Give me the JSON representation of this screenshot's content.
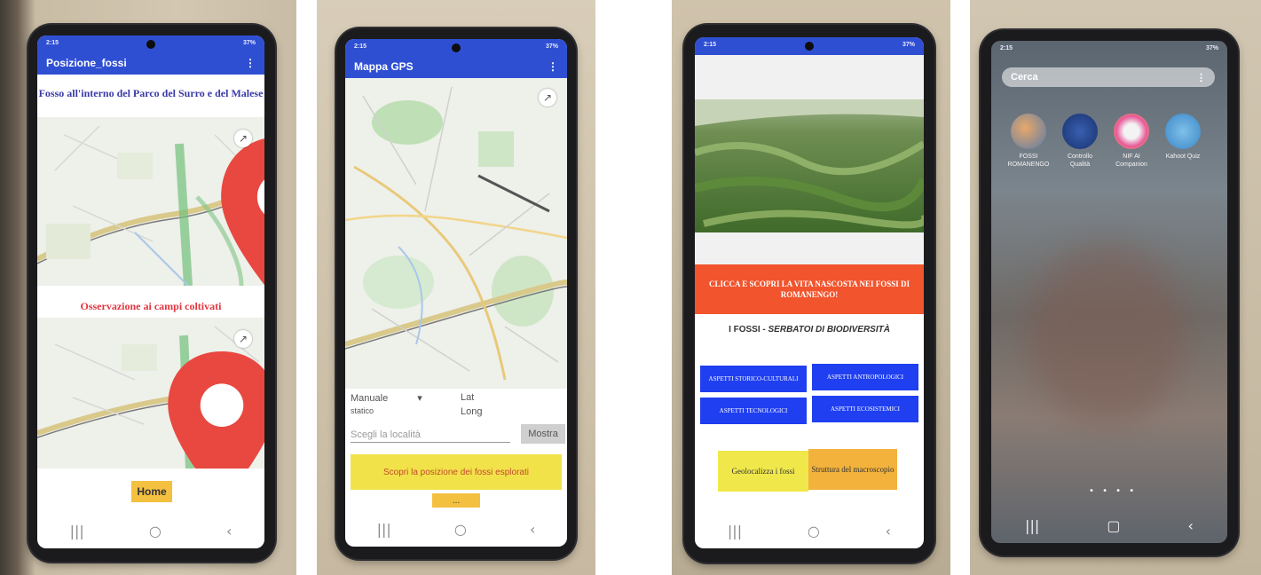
{
  "screen1": {
    "status": {
      "time": "2:15",
      "right": "37%"
    },
    "appbar_title": "Posizione_fossi",
    "menu_icon": "overflow-menu-icon",
    "map1_title": "Fosso all'interno del Parco del Surro e del Malese",
    "map2_title": "Osservazione ai campi coltivati",
    "home_label": "Home"
  },
  "screen2": {
    "status": {
      "time": "2:15",
      "right": "37%"
    },
    "appbar_title": "Mappa GPS",
    "mode_value": "Manuale",
    "mode_sub": "statico",
    "lat_label": "Lat",
    "long_label": "Long",
    "search_placeholder": "Scegli la località",
    "show_button": "Mostra",
    "banner": "Scopri la posizione dei fossi esplorati",
    "bottom_button": "..."
  },
  "screen3": {
    "status": {
      "time": "2:15",
      "right": "37%"
    },
    "banner": "CLICCA E SCOPRI LA VITA NASCOSTA NEI FOSSI DI ROMANENGO!",
    "subtitle_plain": "I FOSSI - ",
    "subtitle_italic": "SERBATOI DI BIODIVERSITÀ",
    "buttons": [
      "ASPETTI STORICO-CULTURALI",
      "ASPETTI ANTROPOLOGICI",
      "ASPETTI TECNOLOGICI",
      "ASPETTI ECOSISTEMICI"
    ],
    "yellow_button": "Geolocalizza i fossi",
    "orange_button": "Struttura del macroscopio"
  },
  "screen4": {
    "status": {
      "time": "2:15",
      "right": "37%"
    },
    "search_label": "Cerca",
    "apps": [
      {
        "label": "FOSSI ROMANENGO",
        "icon": "fossi-app-icon"
      },
      {
        "label": "Controllo Qualità",
        "icon": "quality-app-icon"
      },
      {
        "label": "NIF AI Companion",
        "icon": "companion-app-icon"
      },
      {
        "label": "Kahoot Quiz",
        "icon": "quiz-app-icon"
      }
    ],
    "page_dots": "• • • •"
  },
  "colors": {
    "appbar": "#2f4fd3",
    "pin": "#e8483f",
    "home_button": "#f4c040",
    "red_banner": "#f2542d",
    "blue_button": "#1f3ff0",
    "yellow_button": "#f0e84a",
    "orange_button": "#f2b23c"
  }
}
